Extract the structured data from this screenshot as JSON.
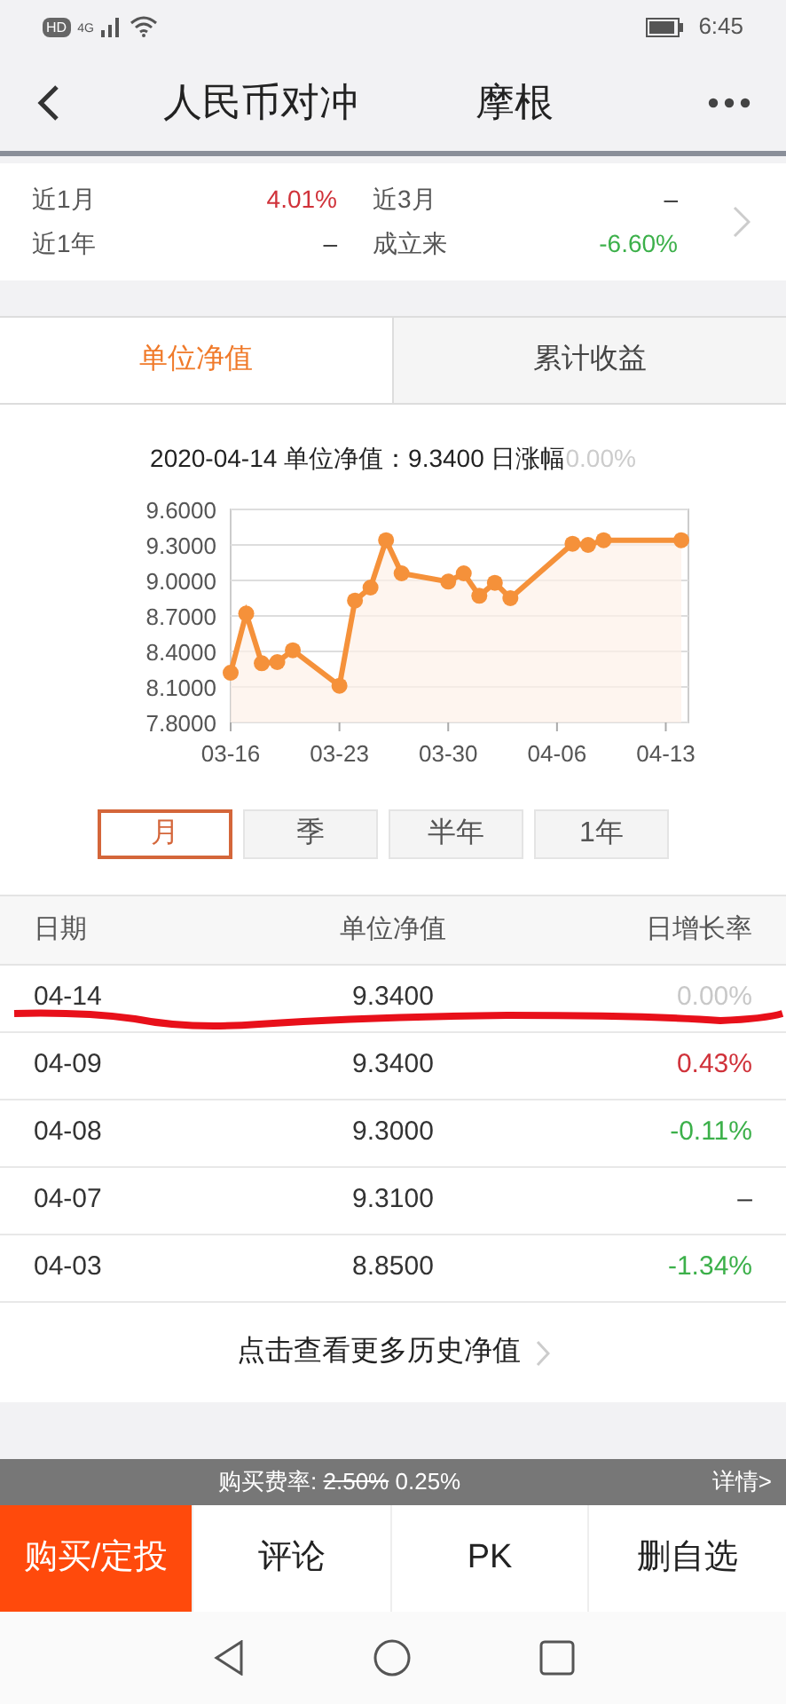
{
  "status_bar": {
    "badge": "HD",
    "network": "4G",
    "time": "6:45"
  },
  "header": {
    "title_left": "人民币对冲",
    "title_right": "摩根"
  },
  "returns": [
    {
      "label": "近1月",
      "value": "4.01%",
      "color": "#d0323a"
    },
    {
      "label": "近3月",
      "value": "–",
      "color": "#333333"
    },
    {
      "label": "近1年",
      "value": "–",
      "color": "#333333"
    },
    {
      "label": "成立来",
      "value": "-6.60%",
      "color": "#3cb04a"
    }
  ],
  "tabs": [
    {
      "label": "单位净值",
      "selected": true
    },
    {
      "label": "累计收益",
      "selected": false
    }
  ],
  "chart_caption": {
    "text": "2020-04-14 单位净值：9.3400 日涨幅",
    "change": "0.00%"
  },
  "chart_data": {
    "type": "area",
    "categories": [
      "03-16",
      null,
      null,
      null,
      null,
      null,
      null,
      "03-23",
      null,
      null,
      null,
      null,
      null,
      null,
      "03-30",
      null,
      null,
      null,
      null,
      null,
      null,
      "04-06",
      null,
      null,
      null,
      null,
      null,
      null,
      "04-13",
      null
    ],
    "series": [
      {
        "color": "#f5913a",
        "values": [
          8.22,
          8.72,
          8.3,
          8.31,
          8.41,
          null,
          null,
          8.11,
          8.83,
          8.94,
          9.34,
          9.06,
          null,
          null,
          8.99,
          9.06,
          8.87,
          8.98,
          8.85,
          null,
          null,
          null,
          9.31,
          9.3,
          9.34,
          null,
          null,
          null,
          null,
          9.34
        ]
      }
    ],
    "ylim": [
      7.8,
      9.6
    ],
    "grid": true,
    "yticks": [
      {
        "value": 9.6,
        "label": "9.6000"
      },
      {
        "value": 9.3,
        "label": "9.3000"
      },
      {
        "value": 9.0,
        "label": "9.0000"
      },
      {
        "value": 8.7,
        "label": "8.7000"
      },
      {
        "value": 8.4,
        "label": "8.4000"
      },
      {
        "value": 8.1,
        "label": "8.1000"
      },
      {
        "value": 7.8,
        "label": "7.8000"
      }
    ]
  },
  "ranges": [
    {
      "label": "月",
      "selected": true
    },
    {
      "label": "季",
      "selected": false
    },
    {
      "label": "半年",
      "selected": false
    },
    {
      "label": "1年",
      "selected": false
    }
  ],
  "table": {
    "columns": [
      "日期",
      "单位净值",
      "日增长率"
    ],
    "rows": [
      {
        "date": "04-14",
        "nav": "9.3400",
        "change": "0.00%",
        "color": "#c8c8c8"
      },
      {
        "date": "04-09",
        "nav": "9.3400",
        "change": "0.43%",
        "color": "#d0323a"
      },
      {
        "date": "04-08",
        "nav": "9.3000",
        "change": "-0.11%",
        "color": "#3cb04a"
      },
      {
        "date": "04-07",
        "nav": "9.3100",
        "change": "–",
        "color": "#333333"
      },
      {
        "date": "04-03",
        "nav": "8.8500",
        "change": "-1.34%",
        "color": "#3cb04a"
      }
    ]
  },
  "more_link": "点击查看更多历史净值",
  "fee_bar": {
    "label": "购买费率:",
    "old_rate": "2.50%",
    "rate": "0.25%",
    "details": "详情>"
  },
  "actions": [
    {
      "label": "购买/定投",
      "primary": true
    },
    {
      "label": "评论",
      "primary": false
    },
    {
      "label": "PK",
      "primary": false
    },
    {
      "label": "删自选",
      "primary": false
    }
  ]
}
